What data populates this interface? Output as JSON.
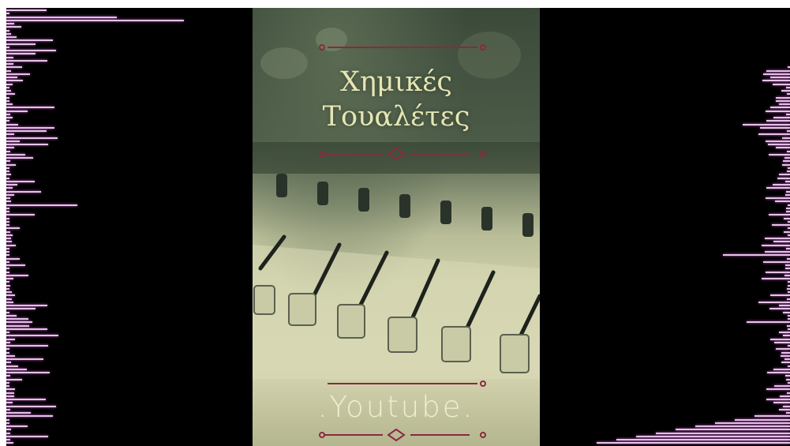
{
  "poster": {
    "title_line1": "Χημικές",
    "title_line2": "Τουαλέτες",
    "brand": ".Youtube.",
    "accent_color": "#8a2a3e",
    "title_color": "#e6e6b4"
  },
  "visualizer": {
    "bar_color": "#e7c3e8",
    "background": "#000000"
  },
  "icons": [
    "ornament-divider-icon",
    "mixing-console-image"
  ]
}
